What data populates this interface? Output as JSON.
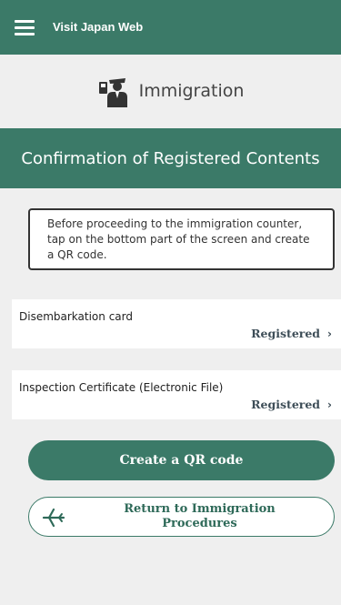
{
  "header": {
    "app_title": "Visit Japan Web"
  },
  "page": {
    "title": "Immigration",
    "section_title": "Confirmation of Registered Contents"
  },
  "notice": {
    "text_line1": "Before proceeding to the immigration counter,",
    "text_line2": "tap on the bottom part of the screen and create",
    "text_line3": "a QR code."
  },
  "items": [
    {
      "label": "Disembarkation card",
      "status": "Registered"
    },
    {
      "label": "Inspection Certificate (Electronic File)",
      "status": "Registered"
    }
  ],
  "actions": {
    "create_qr_label": "Create a QR code",
    "return_label_line1": "Return to Immigration",
    "return_label_line2": "Procedures"
  },
  "colors": {
    "brand": "#3b7a68",
    "background": "#efefef",
    "status_text": "#3d4d57"
  },
  "icons": {
    "menu": "hamburger-icon",
    "page": "immigration-officer-icon",
    "status": "chevron-right-icon",
    "return": "airplane-icon"
  }
}
